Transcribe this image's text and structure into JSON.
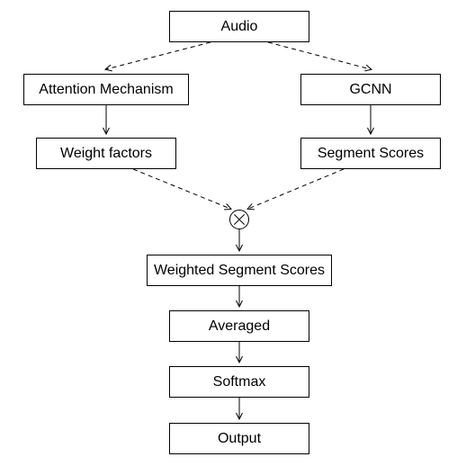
{
  "nodes": {
    "audio": "Audio",
    "attention": "Attention Mechanism",
    "gcnn": "GCNN",
    "weightfactors": "Weight factors",
    "segmentscores": "Segment Scores",
    "weighted": "Weighted Segment Scores",
    "averaged": "Averaged",
    "softmax": "Softmax",
    "output": "Output"
  },
  "chart_data": {
    "type": "diagram",
    "title": "",
    "nodes": [
      {
        "id": "audio",
        "label": "Audio"
      },
      {
        "id": "attention",
        "label": "Attention Mechanism"
      },
      {
        "id": "gcnn",
        "label": "GCNN"
      },
      {
        "id": "weightfactors",
        "label": "Weight factors"
      },
      {
        "id": "segmentscores",
        "label": "Segment Scores"
      },
      {
        "id": "multiply",
        "label": "⊗",
        "operator": true
      },
      {
        "id": "weighted",
        "label": "Weighted Segment Scores"
      },
      {
        "id": "averaged",
        "label": "Averaged"
      },
      {
        "id": "softmax",
        "label": "Softmax"
      },
      {
        "id": "output",
        "label": "Output"
      }
    ],
    "edges": [
      {
        "from": "audio",
        "to": "attention",
        "style": "dashed"
      },
      {
        "from": "audio",
        "to": "gcnn",
        "style": "dashed"
      },
      {
        "from": "attention",
        "to": "weightfactors",
        "style": "solid"
      },
      {
        "from": "gcnn",
        "to": "segmentscores",
        "style": "solid"
      },
      {
        "from": "weightfactors",
        "to": "multiply",
        "style": "dashed"
      },
      {
        "from": "segmentscores",
        "to": "multiply",
        "style": "dashed"
      },
      {
        "from": "multiply",
        "to": "weighted",
        "style": "solid"
      },
      {
        "from": "weighted",
        "to": "averaged",
        "style": "solid"
      },
      {
        "from": "averaged",
        "to": "softmax",
        "style": "solid"
      },
      {
        "from": "softmax",
        "to": "output",
        "style": "solid"
      }
    ]
  }
}
